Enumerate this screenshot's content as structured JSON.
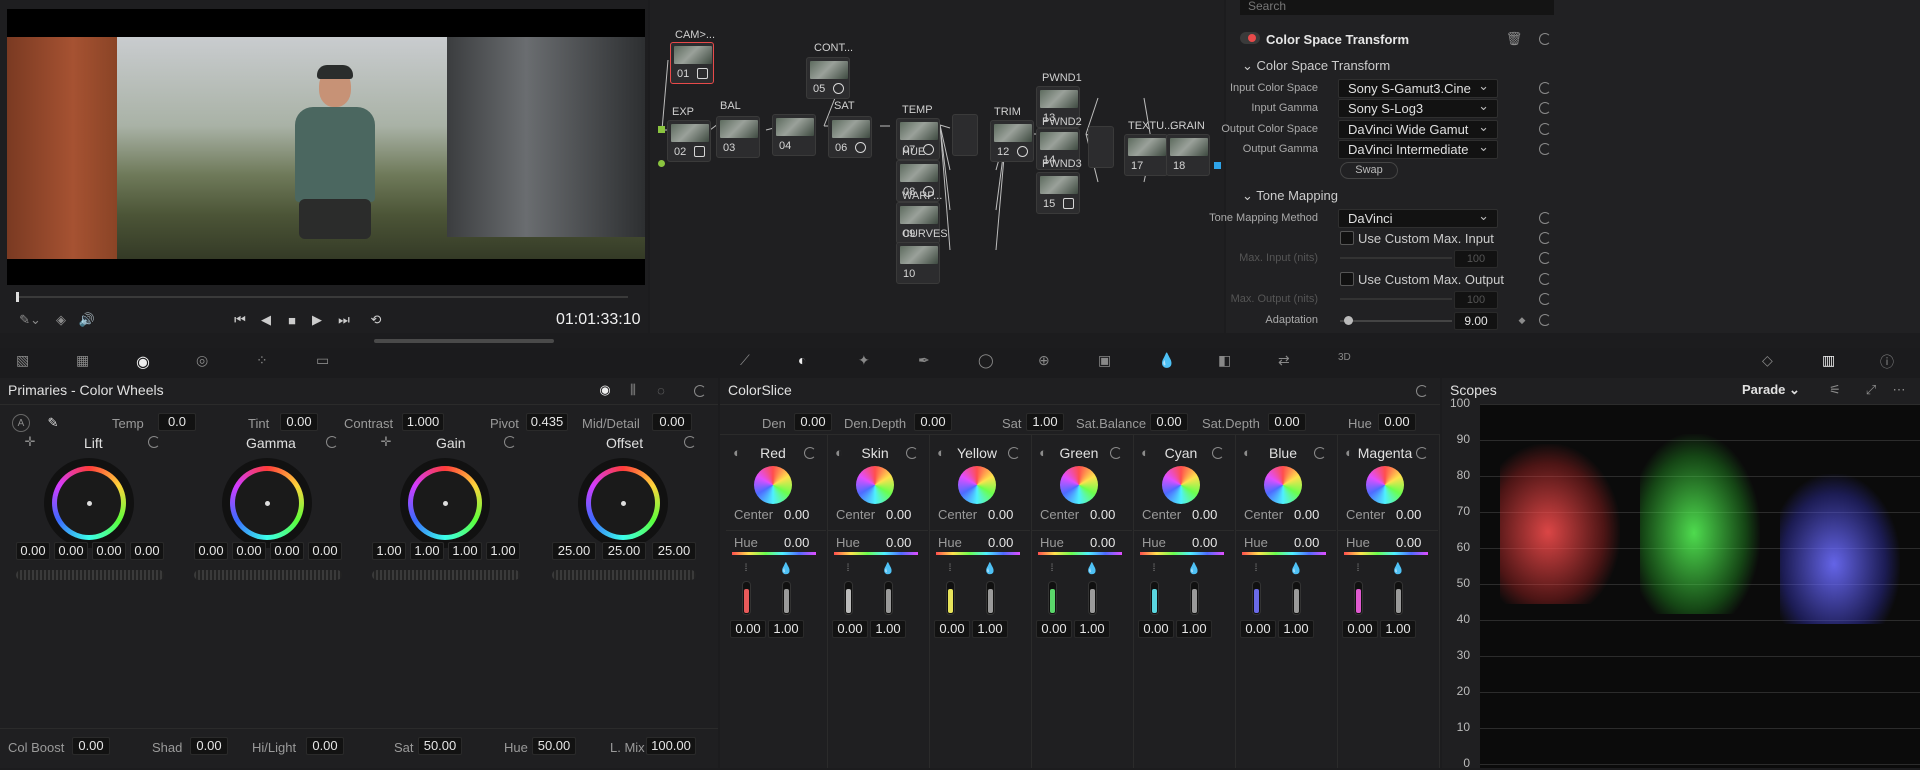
{
  "viewer": {
    "timecode": "01:01:33:10"
  },
  "node_graph": {
    "nodes": [
      {
        "label": "CAM>...",
        "num": "01"
      },
      {
        "label": "EXP",
        "num": "02"
      },
      {
        "label": "BAL",
        "num": "03"
      },
      {
        "label": "",
        "num": "04"
      },
      {
        "label": "CONT...",
        "num": "05"
      },
      {
        "label": "SAT",
        "num": "06"
      },
      {
        "label": "TEMP",
        "num": "07"
      },
      {
        "label": "HUE",
        "num": "08"
      },
      {
        "label": "WARP...",
        "num": "09"
      },
      {
        "label": "CURVES",
        "num": "10"
      },
      {
        "label": "TRIM",
        "num": "12"
      },
      {
        "label": "PWND1",
        "num": "13"
      },
      {
        "label": "PWND2",
        "num": "14"
      },
      {
        "label": "PWND3",
        "num": "15"
      },
      {
        "label": "TEXTU...",
        "num": "17"
      },
      {
        "label": "GRAIN",
        "num": "18"
      }
    ]
  },
  "inspector": {
    "search_placeholder": "Search",
    "title": "Color Space Transform",
    "section1": "Color Space Transform",
    "input_color_space_label": "Input Color Space",
    "input_color_space": "Sony S-Gamut3.Cine",
    "input_gamma_label": "Input Gamma",
    "input_gamma": "Sony S-Log3",
    "output_color_space_label": "Output Color Space",
    "output_color_space": "DaVinci Wide Gamut",
    "output_gamma_label": "Output Gamma",
    "output_gamma": "DaVinci Intermediate",
    "swap": "Swap",
    "section2": "Tone Mapping",
    "tone_method_label": "Tone Mapping Method",
    "tone_method": "DaVinci",
    "custom_input": "Use Custom Max. Input",
    "max_input_label": "Max. Input (nits)",
    "max_input": "100",
    "custom_output": "Use Custom Max. Output",
    "max_output_label": "Max. Output (nits)",
    "max_output": "100",
    "adaptation_label": "Adaptation",
    "adaptation": "9.00"
  },
  "primaries": {
    "title": "Primaries - Color Wheels",
    "temp_label": "Temp",
    "temp": "0.0",
    "tint_label": "Tint",
    "tint": "0.00",
    "contrast_label": "Contrast",
    "contrast": "1.000",
    "pivot_label": "Pivot",
    "pivot": "0.435",
    "middetail_label": "Mid/Detail",
    "middetail": "0.00",
    "wheels": [
      {
        "name": "Lift",
        "vals": [
          "0.00",
          "0.00",
          "0.00",
          "0.00"
        ]
      },
      {
        "name": "Gamma",
        "vals": [
          "0.00",
          "0.00",
          "0.00",
          "0.00"
        ]
      },
      {
        "name": "Gain",
        "vals": [
          "1.00",
          "1.00",
          "1.00",
          "1.00"
        ]
      },
      {
        "name": "Offset",
        "vals": [
          "25.00",
          "25.00",
          "25.00"
        ]
      }
    ],
    "colboost_label": "Col Boost",
    "colboost": "0.00",
    "shad_label": "Shad",
    "shad": "0.00",
    "hilight_label": "Hi/Light",
    "hilight": "0.00",
    "sat_label": "Sat",
    "sat": "50.00",
    "hue_label": "Hue",
    "hue": "50.00",
    "lmix_label": "L. Mix",
    "lmix": "100.00"
  },
  "colorslice": {
    "title": "ColorSlice",
    "den_label": "Den",
    "den": "0.00",
    "dendepth_label": "Den.Depth",
    "dendepth": "0.00",
    "sat_label": "Sat",
    "sat": "1.00",
    "satbal_label": "Sat.Balance",
    "satbal": "0.00",
    "satdepth_label": "Sat.Depth",
    "satdepth": "0.00",
    "hue_label": "Hue",
    "hue": "0.00",
    "center_label": "Center",
    "hue_row_label": "Hue",
    "columns": [
      {
        "name": "Red",
        "center": "0.00",
        "hue": "0.00",
        "a": "0.00",
        "b": "1.00",
        "color": "#e85a5a"
      },
      {
        "name": "Skin",
        "center": "0.00",
        "hue": "0.00",
        "a": "0.00",
        "b": "1.00",
        "color": "#bbbbbb"
      },
      {
        "name": "Yellow",
        "center": "0.00",
        "hue": "0.00",
        "a": "0.00",
        "b": "1.00",
        "color": "#e7e35a"
      },
      {
        "name": "Green",
        "center": "0.00",
        "hue": "0.00",
        "a": "0.00",
        "b": "1.00",
        "color": "#5ad66a"
      },
      {
        "name": "Cyan",
        "center": "0.00",
        "hue": "0.00",
        "a": "0.00",
        "b": "1.00",
        "color": "#5ad6e0"
      },
      {
        "name": "Blue",
        "center": "0.00",
        "hue": "0.00",
        "a": "0.00",
        "b": "1.00",
        "color": "#6a6ae8"
      },
      {
        "name": "Magenta",
        "center": "0.00",
        "hue": "0.00",
        "a": "0.00",
        "b": "1.00",
        "color": "#e05ad0"
      }
    ]
  },
  "scopes": {
    "title": "Scopes",
    "mode": "Parade",
    "ticks": [
      "100",
      "90",
      "80",
      "70",
      "60",
      "50",
      "40",
      "30",
      "20",
      "10",
      "0"
    ]
  },
  "colors": {
    "accent": "#e84a4a",
    "node_green": "#8ac43f",
    "node_blue": "#2ea3e8"
  }
}
